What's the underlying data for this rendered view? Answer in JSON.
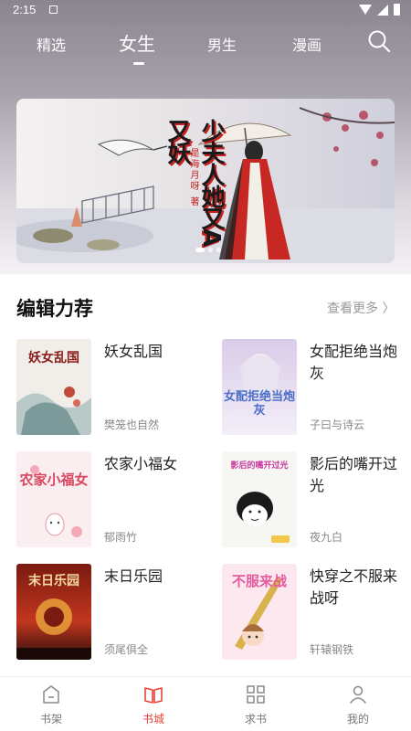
{
  "status_bar": {
    "time": "2:15"
  },
  "top_tabs": [
    {
      "label": "精选",
      "active": false
    },
    {
      "label": "女生",
      "active": true
    },
    {
      "label": "男生",
      "active": false
    },
    {
      "label": "漫画",
      "active": false
    }
  ],
  "banner": {
    "title": "少夫人她又A又妖",
    "author": "是海月呀",
    "author_suffix": "著",
    "page_count": 3,
    "current_page": 1
  },
  "section": {
    "title": "编辑力荐",
    "see_more": "查看更多 〉"
  },
  "books": [
    {
      "title": "妖女乱国",
      "author": "樊笼也自然",
      "cover_text": "妖女乱国"
    },
    {
      "title": "女配拒绝当炮灰",
      "author": "子曰与诗云",
      "cover_text": "女配拒绝当炮灰"
    },
    {
      "title": "农家小福女",
      "author": "郁雨竹",
      "cover_text": "农家小福女"
    },
    {
      "title": "影后的嘴开过光",
      "author": "夜九白",
      "cover_text": "影后的嘴开过光"
    },
    {
      "title": "末日乐园",
      "author": "须尾俱全",
      "cover_text": "末日乐园"
    },
    {
      "title": "快穿之不服来战呀",
      "author": "轩辕钢铁",
      "cover_text": "不服来战"
    }
  ],
  "bottom_nav": [
    {
      "label": "书架",
      "icon": "bookshelf-icon",
      "active": false
    },
    {
      "label": "书城",
      "icon": "book-open-icon",
      "active": true
    },
    {
      "label": "求书",
      "icon": "grid-icon",
      "active": false
    },
    {
      "label": "我的",
      "icon": "person-icon",
      "active": false
    }
  ],
  "colors": {
    "accent": "#e8433a",
    "banner_red": "#c4231f"
  }
}
